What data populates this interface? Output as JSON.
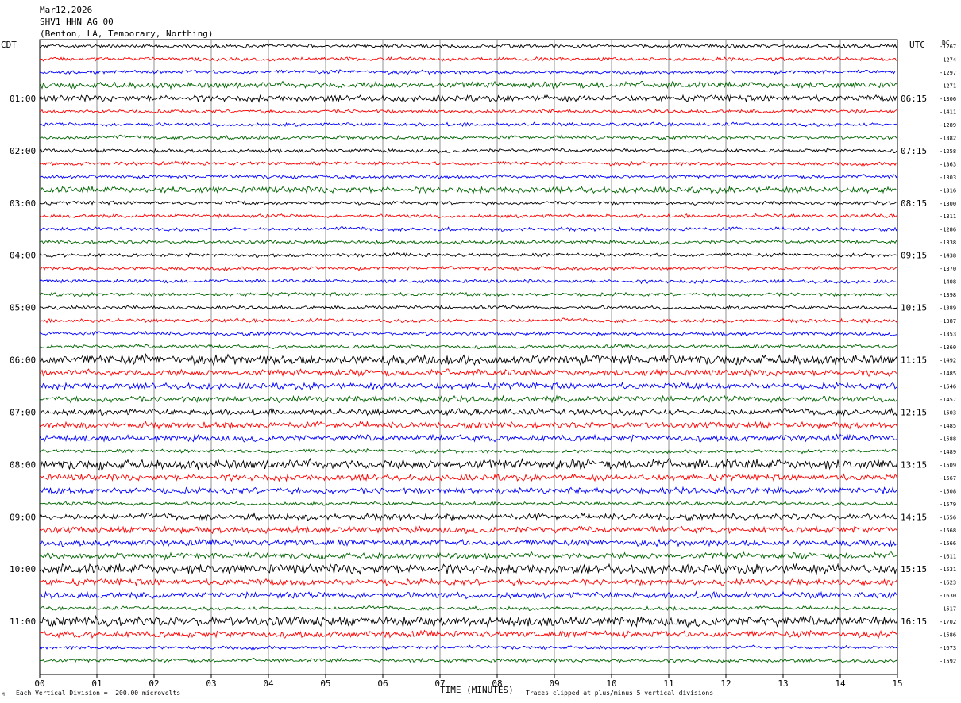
{
  "header": {
    "date": "Mar12,2026",
    "station": "SHV1 HHN AG 00",
    "location": "(Benton, LA, Temporary, Northing)"
  },
  "left_zone": "CDT",
  "right_zone": "UTC",
  "dc_label": "DC",
  "x_axis_title": "TIME (MINUTES)",
  "footer": {
    "scale_note": "Each Vertical Division =  200.00 microvolts",
    "clip_note": "Traces clipped at plus/minus 5 vertical divisions",
    "corner_mark": "M"
  },
  "colors": {
    "black": "#000000",
    "red": "#ff0000",
    "blue": "#0000ff",
    "green": "#006400"
  },
  "chart_data": {
    "type": "line",
    "title": "SHV1 HHN AG 00",
    "xlabel": "TIME (MINUTES)",
    "ylabel": "",
    "x_ticks": [
      "00",
      "01",
      "02",
      "03",
      "04",
      "05",
      "06",
      "07",
      "08",
      "09",
      "10",
      "11",
      "12",
      "13",
      "14",
      "15"
    ],
    "xlim": [
      0,
      15
    ],
    "grid": true,
    "trace_color_cycle": [
      "black",
      "red",
      "blue",
      "green"
    ],
    "left_time_labels": [
      "01:00",
      "02:00",
      "03:00",
      "04:00",
      "05:00",
      "06:00",
      "07:00",
      "08:00",
      "09:00",
      "10:00",
      "11:00"
    ],
    "right_time_labels": [
      "06:15",
      "07:15",
      "08:15",
      "09:15",
      "10:15",
      "11:15",
      "12:15",
      "13:15",
      "14:15",
      "15:15",
      "16:15"
    ],
    "trace_dc_values": [
      -1267,
      -1274,
      -1297,
      -1271,
      -1306,
      -1411,
      -1289,
      -1382,
      -1258,
      -1363,
      -1303,
      -1316,
      -1300,
      -1311,
      -1286,
      -1338,
      -1438,
      -1370,
      -1408,
      -1398,
      -1389,
      -1387,
      -1353,
      -1360,
      -1492,
      -1485,
      -1546,
      -1457,
      -1503,
      -1485,
      -1588,
      -1489,
      -1509,
      -1567,
      -1508,
      -1579,
      -1556,
      -1568,
      -1566,
      -1611,
      -1531,
      -1623,
      -1630,
      -1517,
      -1702,
      -1586,
      -1673,
      -1592
    ],
    "trace_activity": [
      1,
      1,
      1,
      2,
      2,
      1,
      1,
      1,
      1,
      1,
      1,
      2,
      1,
      1,
      1,
      1,
      1,
      1,
      1,
      1,
      1,
      1,
      1,
      1,
      3,
      2,
      2,
      2,
      2,
      2,
      2,
      1,
      3,
      2,
      2,
      1,
      2,
      2,
      2,
      2,
      3,
      2,
      2,
      1,
      3,
      2,
      1,
      1
    ]
  }
}
